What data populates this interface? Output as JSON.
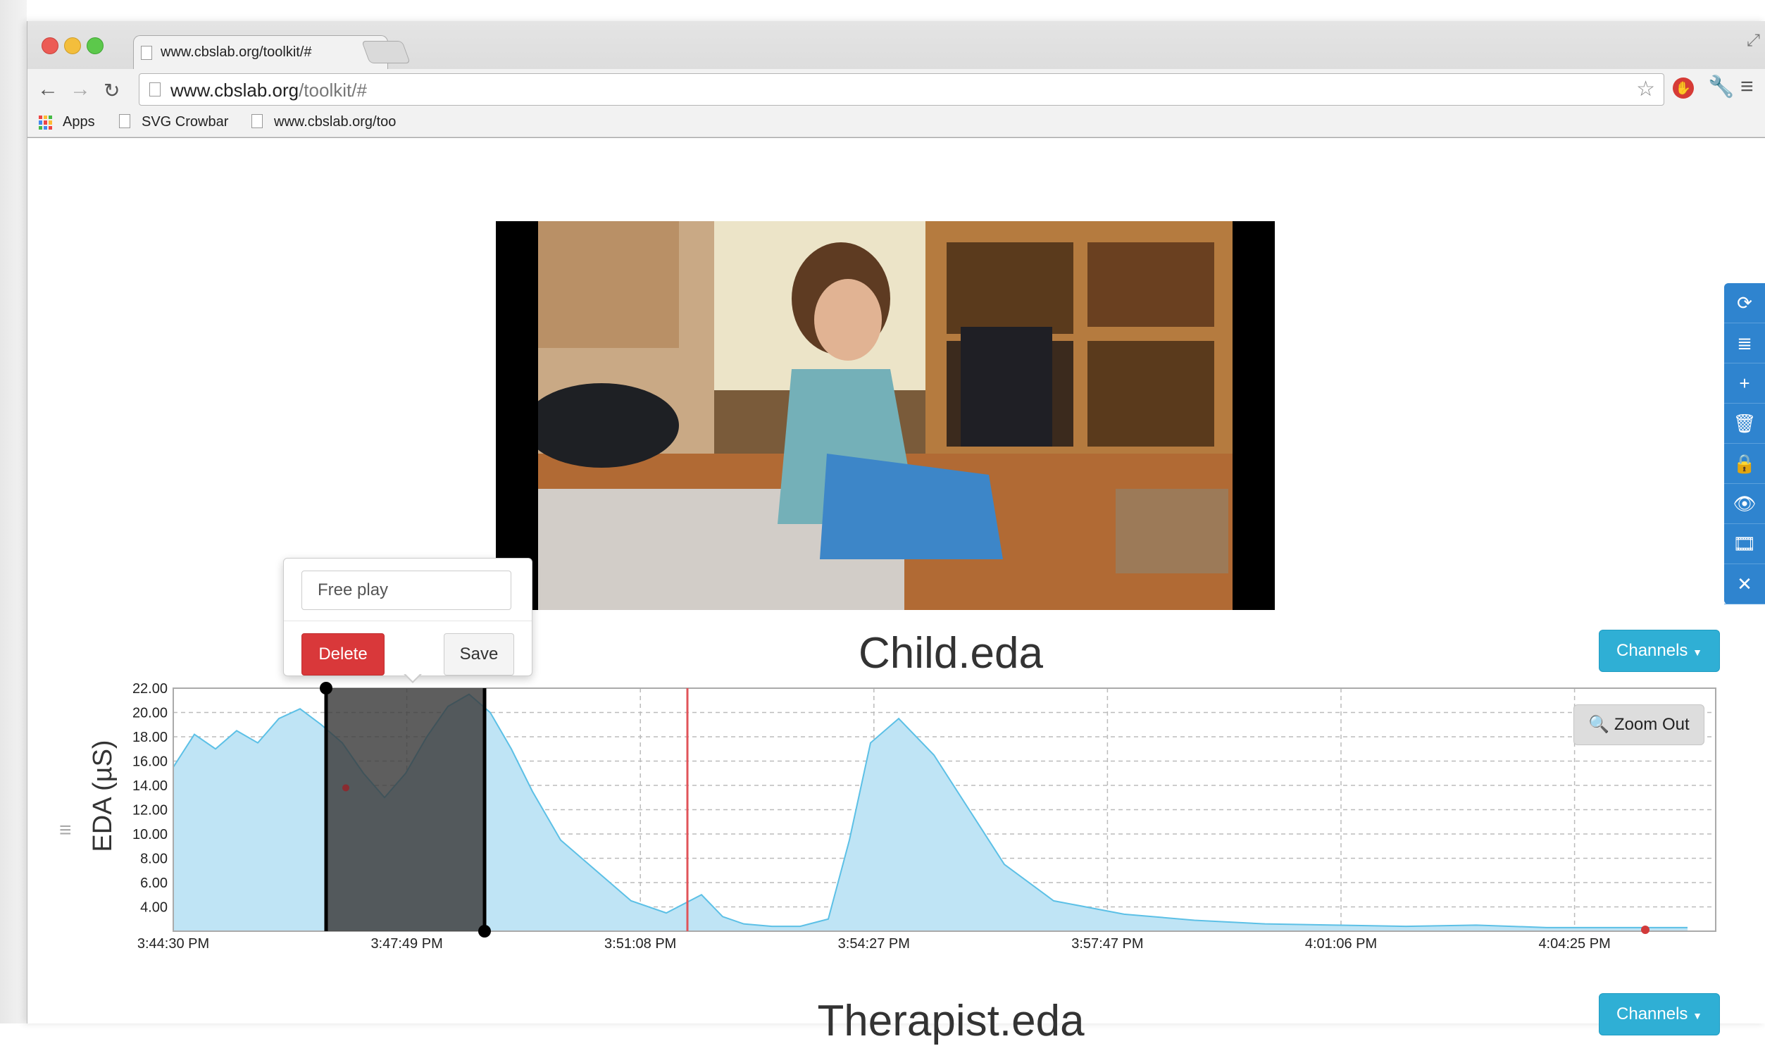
{
  "browser": {
    "tab_title": "www.cbslab.org/toolkit/#",
    "tab_close": "×",
    "url_host": "www.cbslab.org",
    "url_path": "/toolkit/#",
    "bookmarks": [
      {
        "label": "Apps"
      },
      {
        "label": "SVG Crowbar"
      },
      {
        "label": "www.cbslab.org/too"
      }
    ]
  },
  "side_toolbar": {
    "items": [
      {
        "icon": "refresh-icon",
        "glyph": "⟳"
      },
      {
        "icon": "list-icon",
        "glyph": "≣"
      },
      {
        "icon": "plus-icon",
        "glyph": "+"
      },
      {
        "icon": "trash-icon",
        "glyph": "🗑"
      },
      {
        "icon": "lock-icon",
        "glyph": "🔒"
      },
      {
        "icon": "eye-icon",
        "glyph": "👁"
      },
      {
        "icon": "film-icon",
        "glyph": "🎞"
      },
      {
        "icon": "fullscreen-icon",
        "glyph": "✕"
      }
    ]
  },
  "chart1": {
    "title": "Child.eda",
    "channels_label": "Channels",
    "zoom_out_label": "Zoom Out"
  },
  "chart2": {
    "title": "Therapist.eda",
    "channels_label": "Channels"
  },
  "popover": {
    "input_value": "Free play",
    "delete_label": "Delete",
    "save_label": "Save"
  },
  "colors": {
    "series_fill": "#bfe4f5",
    "series_line": "#5cc0e6",
    "selection": "#3b3b3b",
    "cursor": "#e0545a",
    "channels_button": "#2fafd5",
    "delete_button": "#d9383a",
    "side_toolbar": "#2f84cf"
  },
  "chart_data": {
    "type": "area",
    "title": "Child.eda",
    "ylabel": "EDA (µS)",
    "xlabel": "",
    "ylim": [
      2,
      22
    ],
    "yticks": [
      "22.00",
      "20.00",
      "18.00",
      "16.00",
      "14.00",
      "12.00",
      "10.00",
      "8.00",
      "6.00",
      "4.00"
    ],
    "xticks": [
      "3:44:30 PM",
      "3:47:49 PM",
      "3:51:08 PM",
      "3:54:27 PM",
      "3:57:47 PM",
      "4:01:06 PM",
      "4:04:25 PM"
    ],
    "x_minutes_from_start": [
      0,
      0.3,
      0.6,
      0.9,
      1.2,
      1.5,
      1.8,
      2.1,
      2.4,
      2.7,
      3.0,
      3.3,
      3.6,
      3.9,
      4.2,
      4.5,
      4.8,
      5.1,
      5.5,
      6.0,
      6.5,
      7.0,
      7.5,
      7.8,
      8.1,
      8.5,
      8.9,
      9.3,
      9.6,
      9.9,
      10.3,
      10.8,
      11.3,
      11.8,
      12.5,
      13.5,
      14.5,
      15.5,
      16.5,
      17.5,
      18.5,
      19.5,
      20.5,
      21.5
    ],
    "series": [
      {
        "name": "Child.eda",
        "values": [
          15.5,
          18.2,
          17.0,
          18.5,
          17.5,
          19.5,
          20.3,
          19.0,
          17.5,
          15.0,
          13.0,
          15.0,
          18.0,
          20.5,
          21.5,
          20.0,
          17.0,
          13.5,
          9.5,
          7.0,
          4.5,
          3.5,
          5.0,
          3.2,
          2.6,
          2.4,
          2.4,
          3.0,
          9.5,
          17.5,
          19.5,
          16.5,
          12.0,
          7.5,
          4.5,
          3.4,
          2.9,
          2.6,
          2.5,
          2.4,
          2.5,
          2.3,
          2.3,
          2.3
        ]
      }
    ],
    "selection": {
      "start": "3:46:40 PM",
      "end": "3:48:55 PM",
      "label": "Free play"
    },
    "cursor_time": "3:51:48 PM",
    "grid": true
  }
}
